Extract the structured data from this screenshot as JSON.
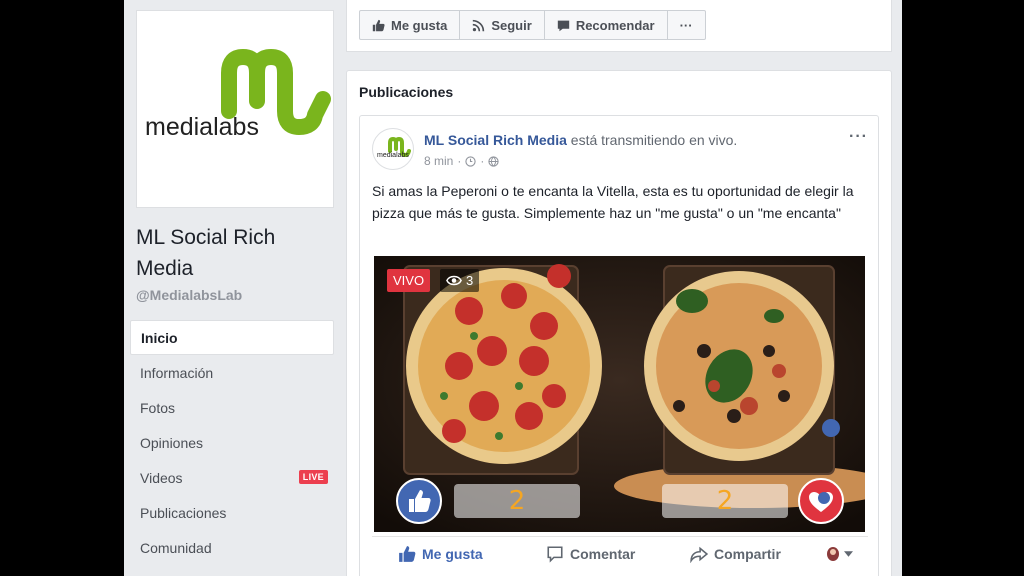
{
  "page": {
    "name": "ML Social Rich Media",
    "handle": "@MedialabsLab",
    "logo_text": "medialabs",
    "logo_monogram": "ml"
  },
  "nav": {
    "items": [
      {
        "label": "Inicio",
        "active": true
      },
      {
        "label": "Información"
      },
      {
        "label": "Fotos"
      },
      {
        "label": "Opiniones"
      },
      {
        "label": "Videos",
        "badge": "LIVE"
      },
      {
        "label": "Publicaciones"
      },
      {
        "label": "Comunidad"
      }
    ]
  },
  "actions": {
    "like": "Me gusta",
    "follow": "Seguir",
    "recommend": "Recomendar",
    "more": "···"
  },
  "posts": {
    "title": "Publicaciones",
    "post": {
      "author": "ML Social Rich Media",
      "action_text": "está transmitiendo en vivo.",
      "time": "8 min",
      "text": "Si amas la Peperoni o te encanta la Vitella, esta es tu oportunidad de elegir la pizza que más te gusta. Simplemente haz un \"me gusta\" o un \"me encanta\"",
      "video": {
        "live_label": "VIVO",
        "viewers": "3",
        "left_count": "2",
        "right_count": "2"
      },
      "buttons": {
        "like": "Me gusta",
        "comment": "Comentar",
        "share": "Compartir"
      }
    }
  },
  "colors": {
    "brand_green": "#7ab51d",
    "fb_blue": "#4267b2",
    "live_red": "#e0343f"
  }
}
